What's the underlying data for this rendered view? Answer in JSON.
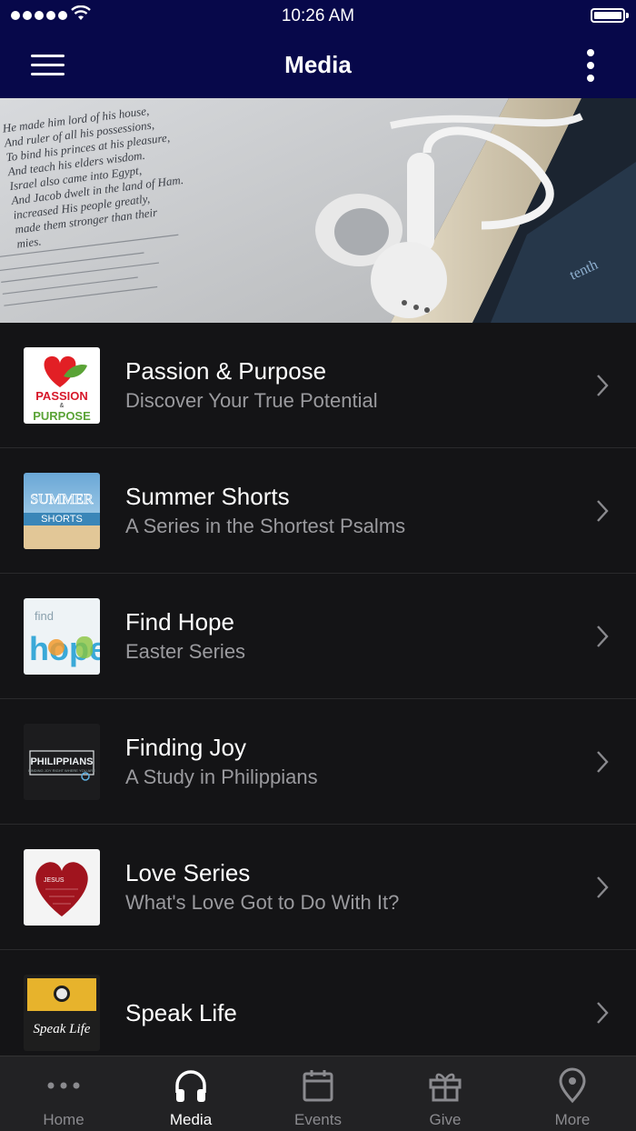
{
  "status": {
    "time": "10:26 AM"
  },
  "nav": {
    "title": "Media"
  },
  "hero": {
    "book_lines": [
      "He made him lord of his house,",
      "And ruler of all his possessions,",
      "To bind his princes at his pleasure,",
      "And teach his elders wisdom.",
      "Israel also came into Egypt,",
      "And Jacob dwelt in the land of Ham.",
      "increased His people greatly,",
      "made them stronger than their",
      "mies."
    ]
  },
  "items": [
    {
      "title": "Passion & Purpose",
      "subtitle": "Discover Your True Potential",
      "thumb_text": [
        "PASSION",
        "&",
        "PURPOSE"
      ]
    },
    {
      "title": "Summer Shorts",
      "subtitle": "A Series in the Shortest Psalms",
      "thumb_text": [
        "SUMMER",
        "SHORTS"
      ]
    },
    {
      "title": "Find Hope",
      "subtitle": "Easter Series",
      "thumb_text": [
        "find",
        "hope"
      ]
    },
    {
      "title": "Finding Joy",
      "subtitle": "A Study in Philippians",
      "thumb_text": [
        "PHILIPPIANS",
        "FINDING JOY RIGHT WHERE YOU ARE"
      ]
    },
    {
      "title": "Love Series",
      "subtitle": "What's Love Got to Do With It?",
      "thumb_text": [
        "JESUS"
      ]
    },
    {
      "title": "Speak Life",
      "subtitle": "",
      "thumb_text": [
        "Speak Life"
      ]
    }
  ],
  "tabs": [
    {
      "label": "Home",
      "icon": "more-dots-icon"
    },
    {
      "label": "Media",
      "icon": "headphones-icon"
    },
    {
      "label": "Events",
      "icon": "calendar-icon"
    },
    {
      "label": "Give",
      "icon": "gift-icon"
    },
    {
      "label": "More",
      "icon": "location-pin-icon"
    }
  ],
  "colors": {
    "nav_bg": "#07084a",
    "list_bg": "#141416",
    "active_tab": "#ffffff",
    "inactive_tab": "#8b8b8f"
  }
}
